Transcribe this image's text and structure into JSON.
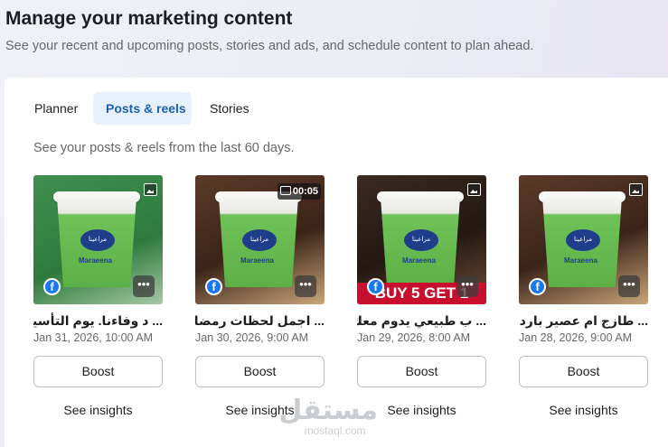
{
  "header": {
    "title": "Manage your marketing content",
    "subtitle": "See your recent and upcoming posts, stories and ads, and schedule content to plan ahead."
  },
  "tabs": [
    {
      "label": "Planner",
      "active": false
    },
    {
      "label": "Posts & reels",
      "active": true
    },
    {
      "label": "Stories",
      "active": false
    }
  ],
  "section_description": "See your posts & reels from the last 60 days.",
  "posts": [
    {
      "title": "... د وفاءنا. يوم التأسيس",
      "date": "Jan 31, 2026, 10:00 AM",
      "media_type_icon": "photo-icon",
      "platform_icon": "facebook-icon",
      "brand_logo_text": "مراعينا",
      "brand_name": "Maraeena",
      "boost_label": "Boost",
      "insights_label": "See insights"
    },
    {
      "title": "... اجمل لحظات رمضان",
      "date": "Jan 30, 2026, 9:00 AM",
      "media_type_icon": "video-icon",
      "video_duration": "00:05",
      "platform_icon": "facebook-icon",
      "brand_logo_text": "مراعينا",
      "brand_name": "Maraeena",
      "boost_label": "Boost",
      "insights_label": "See insights"
    },
    {
      "title": "... ب طبيعي يدوم معك",
      "date": "Jan 29, 2026, 8:00 AM",
      "media_type_icon": "photo-icon",
      "platform_icon": "facebook-icon",
      "promo_text": "BUY 5 GET 1",
      "brand_logo_text": "مراعينا",
      "brand_name": "Maraeena",
      "boost_label": "Boost",
      "insights_label": "See insights"
    },
    {
      "title": "... طازج ام عصير بارد؟",
      "date": "Jan 28, 2026, 9:00 AM",
      "media_type_icon": "photo-icon",
      "platform_icon": "facebook-icon",
      "brand_logo_text": "مراعينا",
      "brand_name": "Maraeena",
      "boost_label": "Boost",
      "insights_label": "See insights"
    }
  ],
  "watermark": {
    "arabic": "مستقل",
    "latin": "mostaql.com"
  },
  "colors": {
    "accent": "#1b61b8",
    "active_tab_bg": "#e7f0fb",
    "facebook_blue": "#1877f2",
    "promo_red": "#c8102e"
  }
}
